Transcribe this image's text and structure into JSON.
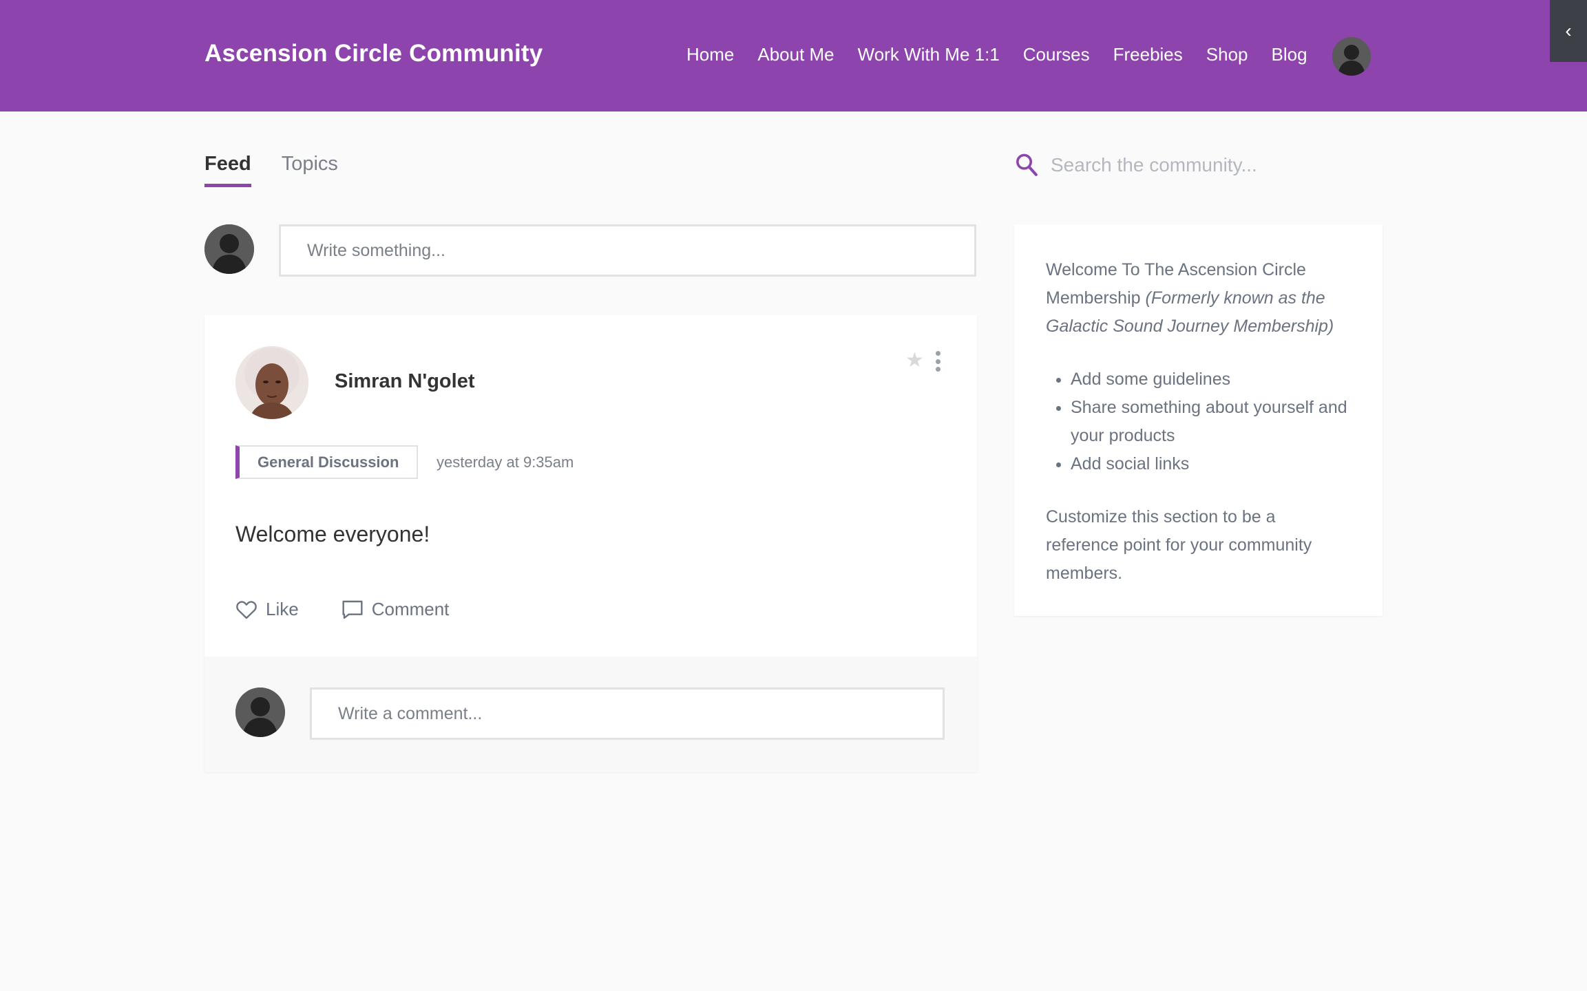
{
  "header": {
    "brand": "Ascension Circle Community",
    "nav": [
      "Home",
      "About Me",
      "Work With Me 1:1",
      "Courses",
      "Freebies",
      "Shop",
      "Blog"
    ],
    "accent_color": "#8e44ad"
  },
  "tabs": [
    {
      "label": "Feed",
      "active": true
    },
    {
      "label": "Topics",
      "active": false
    }
  ],
  "composer": {
    "placeholder": "Write something..."
  },
  "post": {
    "author": "Simran N'golet",
    "topic": "General Discussion",
    "time": "yesterday at 9:35am",
    "body": "Welcome everyone!",
    "like_label": "Like",
    "comment_label": "Comment",
    "comment_placeholder": "Write a comment..."
  },
  "search": {
    "placeholder": "Search the community..."
  },
  "sidebar": {
    "intro": "Welcome To The Ascension Circle Membership ",
    "intro_italic": "(Formerly known as the Galactic Sound Journey Membership)",
    "bullets": [
      "Add some guidelines",
      "Share something about yourself and your products",
      "Add social links"
    ],
    "footer": "Customize this section to be a reference point for your community members."
  },
  "icons": {
    "collapse": "chevron-left-icon",
    "search": "search-icon",
    "star": "star-icon",
    "menu": "more-vertical-icon",
    "like": "heart-icon",
    "comment": "comment-icon"
  }
}
